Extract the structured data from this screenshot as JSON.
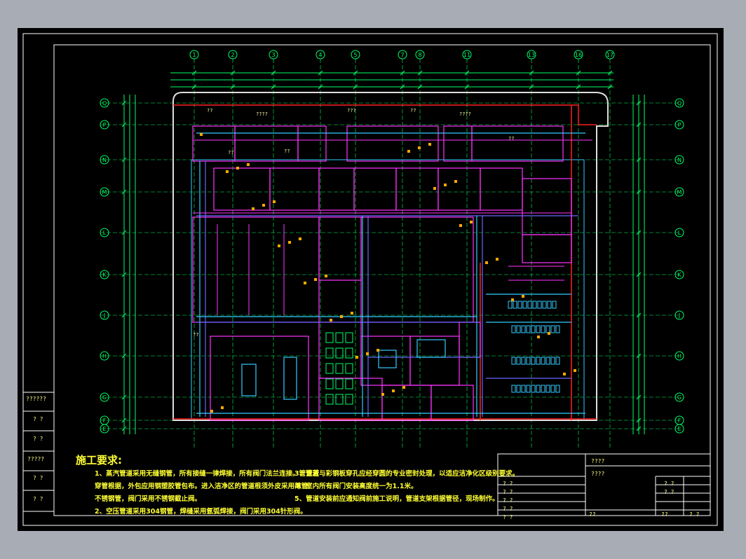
{
  "colors": {
    "background": "#a8adb5",
    "sheet": "#000000",
    "border": "#ffffff",
    "grid": "#00ff66",
    "wall_red": "#ff2020",
    "pipe_magenta": "#ff33ff",
    "pipe_cyan": "#33ccff",
    "pipe_blue": "#6666ff",
    "text_yellow": "#ffff33"
  },
  "column_axes": [
    "1",
    "2",
    "3",
    "4",
    "5",
    "7",
    "8",
    "11",
    "13",
    "16",
    "17"
  ],
  "row_axes": [
    "Q",
    "P",
    "N",
    "M",
    "L",
    "K",
    "J",
    "H",
    "G",
    "F",
    "E"
  ],
  "room_labels": [
    "??",
    "????",
    "???",
    "??",
    "????",
    "??",
    "??",
    "??",
    "??"
  ],
  "left_strip": [
    "??????",
    "? ?",
    "? ?",
    "?????",
    "? ?",
    "? ?"
  ],
  "notes": {
    "title": "施工要求:",
    "items": [
      "1、蒸汽管道采用无缝钢管，所有接缝一律焊接，所有阀门法兰连接。管道若",
      "   穿管根据，外包应用钢塑胶管包布。进入洁净区的管道根须外皮采用薄管",
      "   不锈钢管，阀门采用不锈钢截止阀。",
      "2、空压管道采用304钢管，焊缝采用氩弧焊接，阀门采用304针形阀。",
      "3、管道与彩钢板穿孔应经穿圆的专业密封处理，以适应洁净化区级别要求。",
      "4、室内所有阀门安装高度统一为1.1米。",
      "5、管道安装前应通知阀前施工说明，管道支架根据管径，现场制作。"
    ]
  },
  "title_block": {
    "row1": "????",
    "row2": "????",
    "cells": [
      "? ?",
      "? ?",
      "? ?",
      "? ?",
      "? ?",
      "? ?",
      "? ?"
    ],
    "right_cells": [
      "? ?",
      "? ?",
      "? ?",
      "? ?"
    ],
    "bottom": [
      "??",
      "??",
      "?  ?"
    ]
  }
}
